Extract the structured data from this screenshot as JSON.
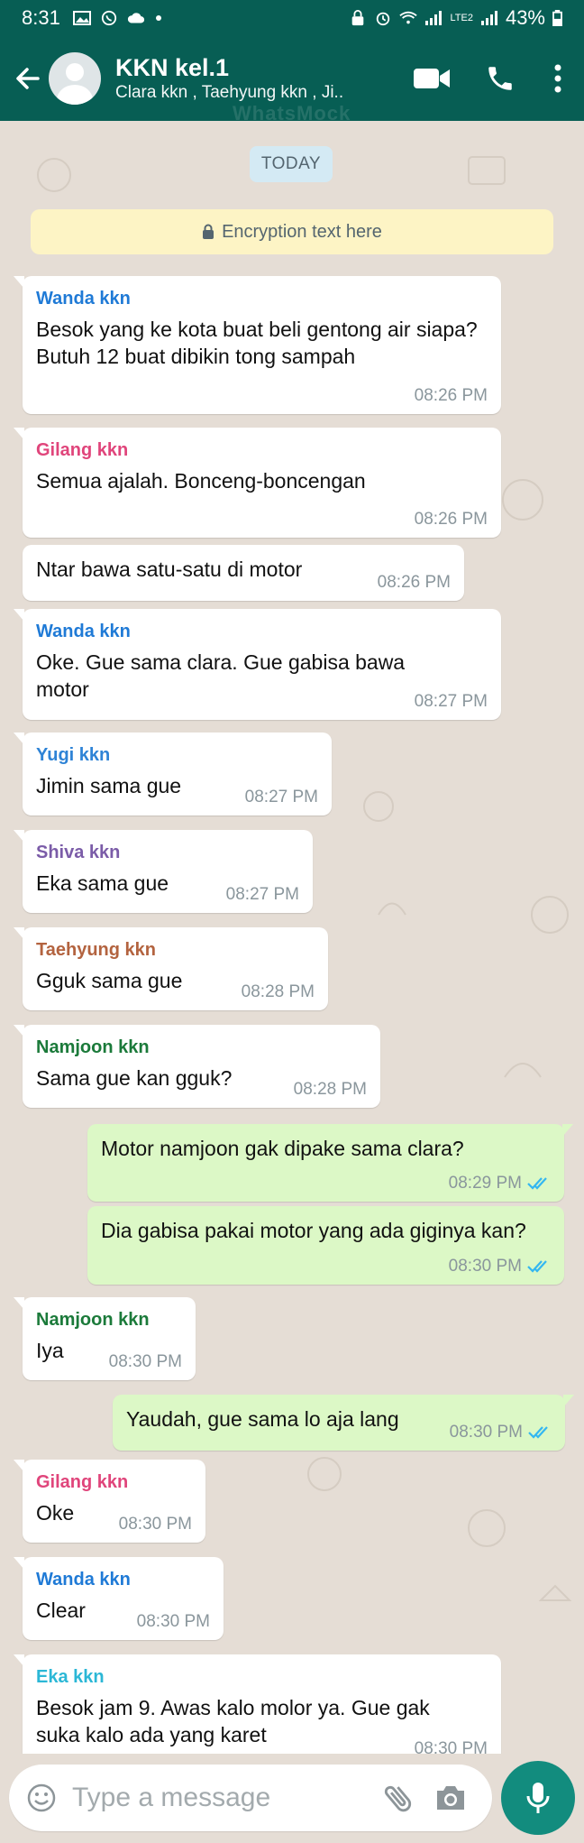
{
  "status_bar": {
    "time": "8:31",
    "battery": "43%",
    "network": "LTE2"
  },
  "header": {
    "title": "KKN kel.1",
    "subtitle": "Clara kkn , Taehyung kkn , Ji..",
    "watermark": "WhatsMock"
  },
  "chat": {
    "date_label": "TODAY",
    "encryption_notice": "Encryption text here",
    "messages": [
      {
        "type": "in",
        "sender": "Wanda kkn",
        "text": "Besok yang ke kota buat beli gentong air siapa? Butuh 12 buat dibikin tong sampah",
        "time": "08:26 PM"
      },
      {
        "type": "in",
        "sender": "Gilang kkn",
        "text": "Semua ajalah. Bonceng-boncengan",
        "time": "08:26 PM"
      },
      {
        "type": "in",
        "sender": "",
        "text": "Ntar bawa satu-satu di motor",
        "time": "08:26 PM"
      },
      {
        "type": "in",
        "sender": "Wanda kkn",
        "text": "Oke. Gue sama clara. Gue gabisa bawa motor",
        "time": "08:27 PM"
      },
      {
        "type": "in",
        "sender": "Yugi kkn",
        "text": "Jimin sama gue",
        "time": "08:27 PM"
      },
      {
        "type": "in",
        "sender": "Shiva kkn",
        "text": "Eka sama gue",
        "time": "08:27 PM"
      },
      {
        "type": "in",
        "sender": "Taehyung kkn",
        "text": "Gguk sama gue",
        "time": "08:28 PM"
      },
      {
        "type": "in",
        "sender": "Namjoon kkn",
        "text": "Sama gue kan gguk?",
        "time": "08:28 PM"
      },
      {
        "type": "out",
        "sender": "",
        "text": "Motor namjoon gak dipake sama clara?",
        "time": "08:29 PM"
      },
      {
        "type": "out",
        "sender": "",
        "text": "Dia gabisa pakai motor yang ada giginya kan?",
        "time": "08:30 PM"
      },
      {
        "type": "in",
        "sender": "Namjoon kkn",
        "text": "Iya",
        "time": "08:30 PM"
      },
      {
        "type": "out",
        "sender": "",
        "text": "Yaudah, gue sama lo aja lang",
        "time": "08:30 PM"
      },
      {
        "type": "in",
        "sender": "Gilang kkn",
        "text": "Oke",
        "time": "08:30 PM"
      },
      {
        "type": "in",
        "sender": "Wanda kkn",
        "text": "Clear",
        "time": "08:30 PM"
      },
      {
        "type": "in",
        "sender": "Eka kkn",
        "text": "Besok jam 9. Awas kalo molor ya. Gue gak suka kalo ada yang karet",
        "time": "08:30 PM"
      }
    ]
  },
  "input_bar": {
    "placeholder": "Type a message"
  },
  "colors": {
    "header": "#075e54",
    "chat_bg": "#e5ddd5",
    "outgoing_bubble": "#dcf8c6",
    "incoming_bubble": "#ffffff",
    "read_ticks": "#34b7f1",
    "mic_button": "#128c7e",
    "sender_wanda": "#1f7ad6",
    "sender_gilang": "#e0457b",
    "sender_yugi": "#2e83d6",
    "sender_shiva": "#7b5ca8",
    "sender_taehyung": "#b3633f",
    "sender_namjoon": "#1b7a3a",
    "sender_eka": "#2bb7d6"
  }
}
